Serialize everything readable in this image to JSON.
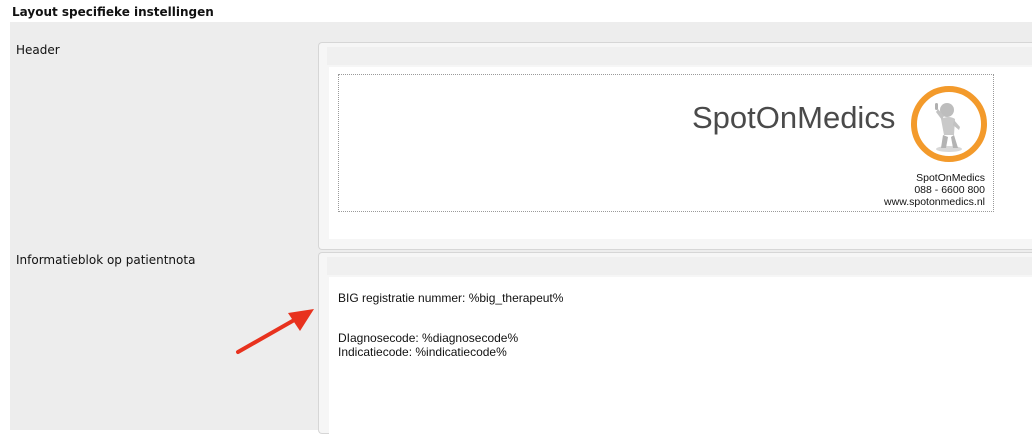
{
  "section": {
    "title": "Layout specifieke instellingen"
  },
  "header_row": {
    "label": "Header",
    "brand_name": "SpotOnMedics",
    "contact": {
      "name": "SpotOnMedics",
      "phone": "088 - 6600 800",
      "website": "www.spotonmedics.nl"
    },
    "logo_icon": "thumbs-up-figure-logo",
    "logo_ring_color": "#f39a2b"
  },
  "info_row": {
    "label": "Informatieblok op patientnota",
    "lines": {
      "big": "BIG registratie nummer: %big_therapeut%",
      "diagnose": "DIagnosecode: %diagnosecode%",
      "indicatie": "Indicatiecode: %indicatiecode%"
    }
  },
  "annotation": {
    "arrow_color": "#e8321e"
  }
}
